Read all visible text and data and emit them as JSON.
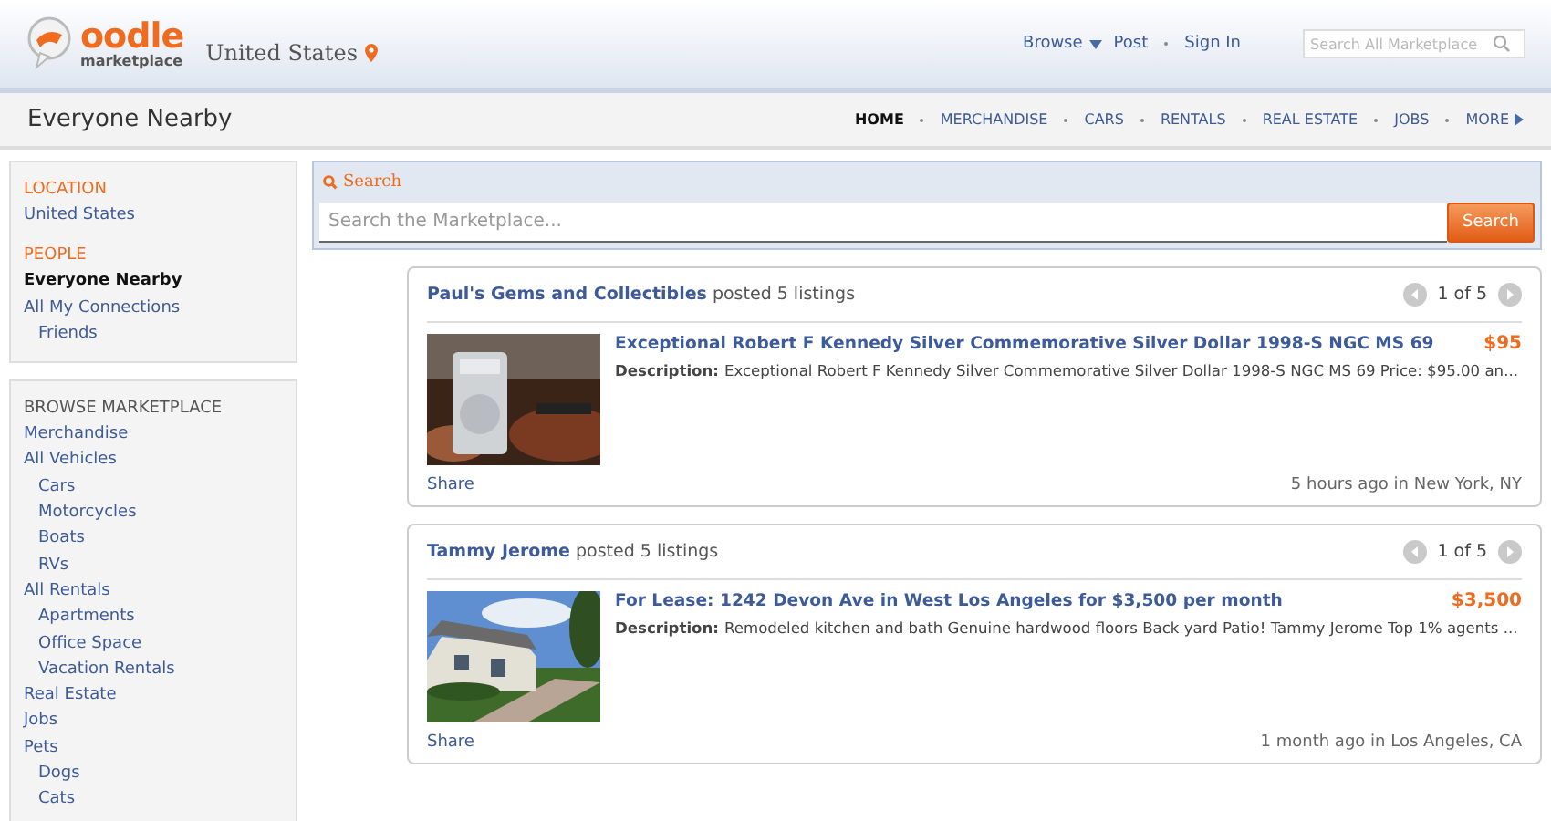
{
  "header": {
    "logo_word": "oodle",
    "logo_sub": "marketplace",
    "location": "United States",
    "links": [
      {
        "label": "Browse",
        "dropdown": true
      },
      {
        "label": "Post",
        "dropdown": false
      },
      {
        "label": "Sign In",
        "dropdown": false
      }
    ],
    "search": {
      "placeholder": "Search All Marketplace"
    }
  },
  "title_bar": {
    "title": "Everyone Nearby",
    "nav": [
      {
        "label": "HOME",
        "selected": true
      },
      {
        "label": "MERCHANDISE",
        "selected": false
      },
      {
        "label": "CARS",
        "selected": false
      },
      {
        "label": "RENTALS",
        "selected": false
      },
      {
        "label": "REAL ESTATE",
        "selected": false
      },
      {
        "label": "JOBS",
        "selected": false
      },
      {
        "label": "MORE",
        "selected": false
      }
    ]
  },
  "sidebar": {
    "panels": [
      {
        "sections": [
          {
            "heading": "LOCATION",
            "kind": "accent",
            "items": [
              {
                "label": "United States",
                "selected": false
              }
            ]
          },
          {
            "heading": "PEOPLE",
            "kind": "accent",
            "items": [
              {
                "label": "Everyone Nearby",
                "selected": true
              },
              {
                "label": "All My Connections",
                "selected": false,
                "children": [
                  {
                    "label": "Friends",
                    "selected": false
                  }
                ]
              }
            ]
          }
        ]
      },
      {
        "sections": [
          {
            "heading": "BROWSE MARKETPLACE",
            "kind": "plain",
            "items": [
              {
                "label": "Merchandise",
                "selected": false
              },
              {
                "label": "All Vehicles",
                "selected": false,
                "children": [
                  {
                    "label": "Cars",
                    "selected": false
                  },
                  {
                    "label": "Motorcycles",
                    "selected": false
                  },
                  {
                    "label": "Boats",
                    "selected": false
                  },
                  {
                    "label": "RVs",
                    "selected": false
                  }
                ]
              },
              {
                "label": "All Rentals",
                "selected": false,
                "children": [
                  {
                    "label": "Apartments",
                    "selected": false
                  },
                  {
                    "label": "Office Space",
                    "selected": false
                  },
                  {
                    "label": "Vacation Rentals",
                    "selected": false
                  }
                ]
              },
              {
                "label": "Real Estate",
                "selected": false
              },
              {
                "label": "Jobs",
                "selected": false
              },
              {
                "label": "Pets",
                "selected": false,
                "children": [
                  {
                    "label": "Dogs",
                    "selected": false
                  },
                  {
                    "label": "Cats",
                    "selected": false
                  }
                ]
              }
            ]
          }
        ]
      }
    ]
  },
  "search": {
    "label": "Search",
    "placeholder": "Search the Marketplace...",
    "button": "Search"
  },
  "feed": [
    {
      "poster": "Paul's Gems and Collectibles",
      "posted": "posted 5 listings",
      "pager": "1 of 5",
      "listing": {
        "kind": "coin",
        "title": "Exceptional Robert F Kennedy Silver Commemorative Silver Dollar 1998-S NGC MS 69",
        "price": "$95",
        "desc_label": "Description:",
        "description": "Exceptional Robert F Kennedy Silver Commemorative Silver Dollar 1998-S NGC MS 69 Price: $95.00 an..."
      },
      "share": "Share",
      "meta": "5 hours ago in New York, NY"
    },
    {
      "poster": "Tammy Jerome",
      "posted": "posted 5 listings",
      "pager": "1 of 5",
      "listing": {
        "kind": "house",
        "title": "For Lease: 1242 Devon Ave in West Los Angeles for $3,500 per month",
        "price": "$3,500",
        "desc_label": "Description:",
        "description": "Remodeled kitchen and bath Genuine hardwood floors Back yard Patio! Tammy Jerome Top 1% agents ..."
      },
      "share": "Share",
      "meta": "1 month ago in Los Angeles, CA"
    }
  ]
}
